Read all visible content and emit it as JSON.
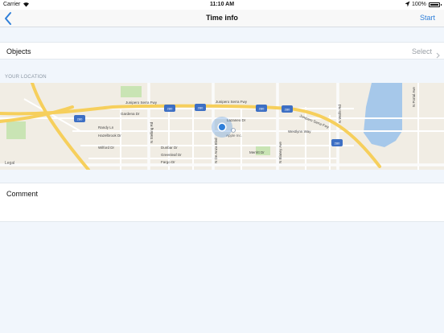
{
  "status_bar": {
    "carrier": "Carrier",
    "time": "11:10 AM",
    "battery": "100%"
  },
  "nav": {
    "title": "Time info",
    "start_label": "Start"
  },
  "objects": {
    "label": "Objects",
    "value": "Select"
  },
  "location": {
    "header": "YOUR LOCATION",
    "legal": "Legal"
  },
  "map": {
    "roads": {
      "junipero_1": "Junipero Serra Fwy",
      "junipero_2": "Junipero Serra Fwy",
      "junipero_3": "Junipero Serra Fwy",
      "n_stelling": "N Stelling Rd",
      "de_anza": "N De Anza Blvd",
      "n_blaney": "N Blaney Ave",
      "n_wolfe": "N Wolfe Rd",
      "n_portal": "N Portal Ave",
      "apple_inc": "Apple Inc.",
      "shield": "280",
      "street_1": "Randy Ln",
      "street_2": "Hazelbrook Dr",
      "street_3": "Wilford Dr",
      "street_4": "Dunbar Dr",
      "street_5": "Greenleaf Dr",
      "street_6": "Fargo Dr",
      "street_7": "Merritt Dr",
      "street_8": "Westlynn Way",
      "street_9": "Lazaneo Dr",
      "street_10": "Gardena Dr"
    }
  },
  "comment": {
    "label": "Comment"
  },
  "colors": {
    "accent": "#2f7fd9",
    "freeway": "#f6cf5c",
    "water": "#a6c8ea",
    "park": "#c9e4b4"
  }
}
